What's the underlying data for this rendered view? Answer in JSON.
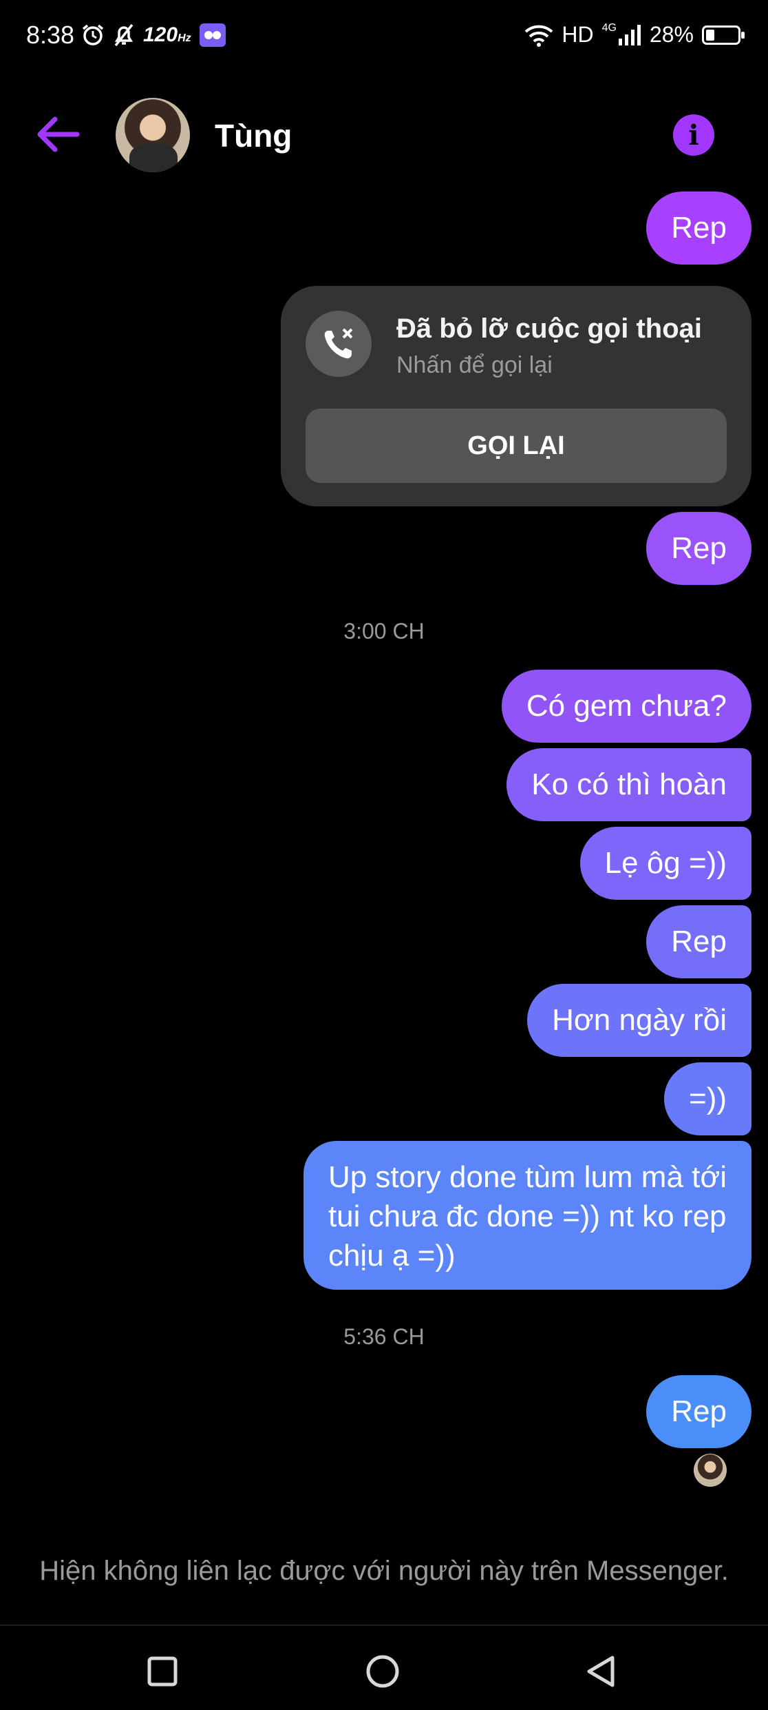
{
  "status_bar": {
    "time": "8:38",
    "refresh_rate": "120",
    "refresh_unit": "Hz",
    "network": "HD",
    "network_type": "4G",
    "battery_text": "28%",
    "battery_level": 0.28,
    "icons": [
      "alarm-icon",
      "bell-off-icon",
      "app-notification-icon",
      "wifi-icon",
      "signal-icon",
      "battery-icon"
    ]
  },
  "header": {
    "contact_name": "Tùng",
    "back_icon": "arrow-left-icon",
    "info_icon": "info-icon",
    "accent_color": "#a238ff"
  },
  "messages": {
    "m1": "Rep",
    "missed_call": {
      "title": "Đã bỏ lỡ cuộc gọi thoại",
      "subtitle": "Nhấn để gọi lại",
      "button": "GỌI LẠI",
      "icon": "missed-call-icon"
    },
    "m2": "Rep",
    "timestamp_1": "3:00 CH",
    "m3": "Có gem chưa?",
    "m4": "Ko có thì hoàn",
    "m5": "Lẹ ôg =))",
    "m6": "Rep",
    "m7": "Hơn ngày rồi",
    "m8": "=))",
    "m9": "Up story done tùm lum mà tới\ntui chưa đc done =)) nt ko rep\nchịu ạ =))",
    "timestamp_2": "5:36 CH",
    "m10": "Rep"
  },
  "footer_notice": "Hiện không liên lạc được với người này trên Messenger.",
  "nav_bar": {
    "icons": [
      "recent-apps-icon",
      "home-icon",
      "back-icon"
    ]
  }
}
